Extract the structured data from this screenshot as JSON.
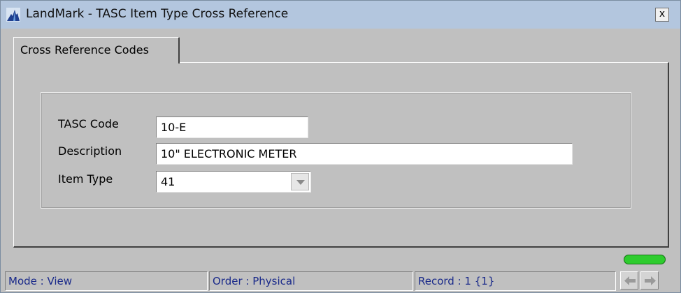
{
  "window": {
    "title": "LandMark - TASC Item Type Cross Reference",
    "close_label": "x"
  },
  "tabs": [
    {
      "label": "Cross Reference Codes",
      "active": true
    }
  ],
  "form": {
    "tasc_code": {
      "label": "TASC Code",
      "value": "10-E"
    },
    "description": {
      "label": "Description",
      "value": "10\" ELECTRONIC METER"
    },
    "item_type": {
      "label": "Item Type",
      "value": "41"
    }
  },
  "status": {
    "mode": "Mode : View",
    "order": "Order : Physical",
    "record": "Record : 1 {1}"
  },
  "icons": {
    "app": "landmark-app-icon",
    "close": "close-icon",
    "dropdown": "chevron-down-icon",
    "prev": "arrow-left-icon",
    "next": "arrow-right-icon",
    "indicator": "status-indicator-icon"
  },
  "colors": {
    "titlebar": "#b3c6de",
    "status_text": "#1a2a8a",
    "indicator": "#2ecc2e"
  }
}
